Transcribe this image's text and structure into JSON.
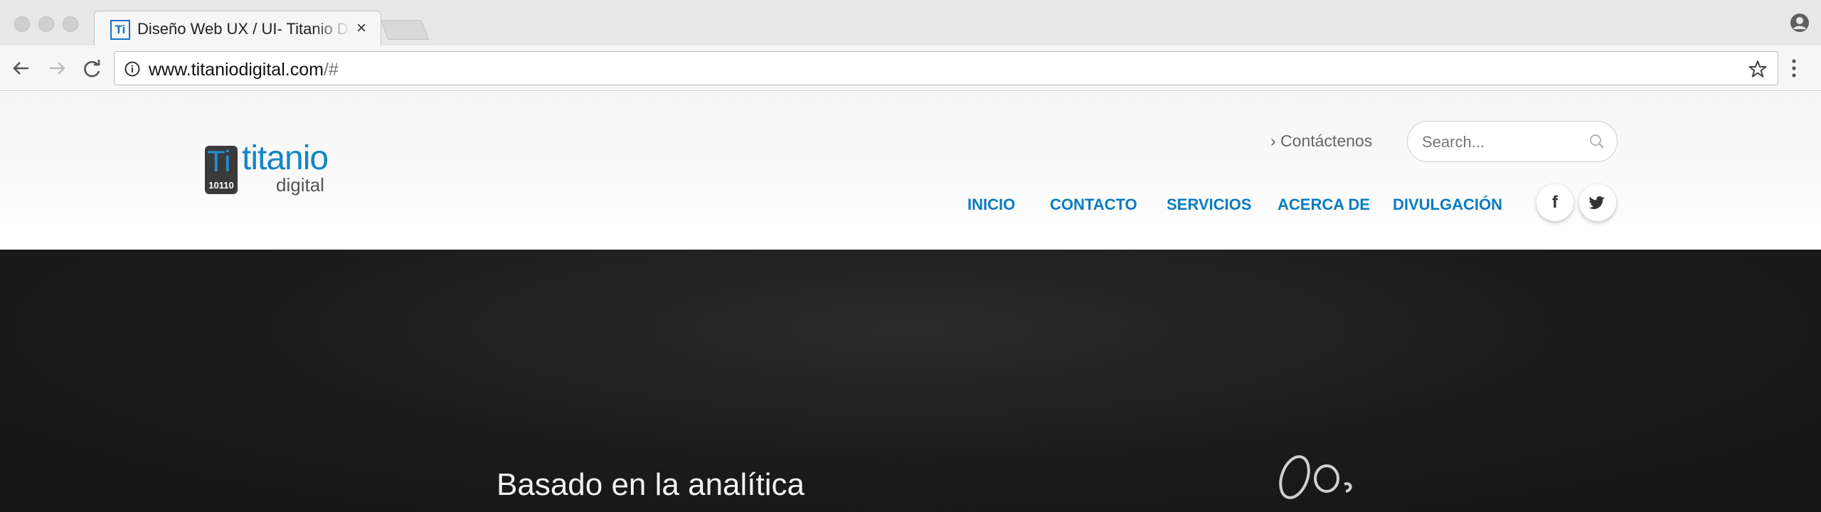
{
  "browser": {
    "tab": {
      "favicon": "Ti",
      "title": "Diseño Web UX / UI- Titanio Digital",
      "close": "×"
    },
    "url": {
      "host": "www.titaniodigital.com",
      "path": "/#"
    },
    "icons": [
      "back-arrow-icon",
      "forward-arrow-icon",
      "reload-icon",
      "info-icon",
      "star-icon",
      "profile-icon",
      "kebab-menu-icon"
    ]
  },
  "site": {
    "logo": {
      "mark_letters": "Ti",
      "mark_binary": "10110",
      "word": "titanio",
      "sub": "digital"
    },
    "contact_link": "› Contáctenos",
    "search": {
      "placeholder": "Search..."
    },
    "nav": [
      "INICIO",
      "CONTACTO",
      "SERVICIOS",
      "ACERCA DE",
      "DIVULGACIÓN"
    ],
    "social": {
      "facebook": "f",
      "twitter_icon": "twitter-bird-icon"
    },
    "accent_color": "#0a7cc0",
    "hero": {
      "headline": "Basado en la analítica"
    }
  }
}
